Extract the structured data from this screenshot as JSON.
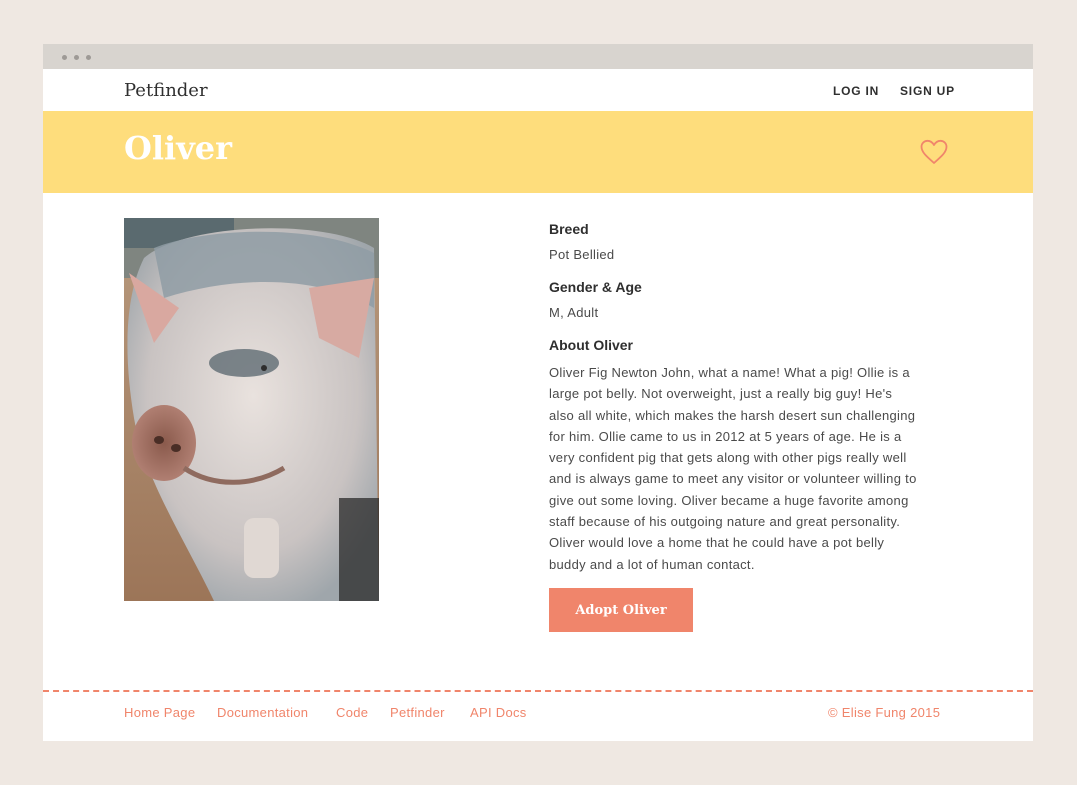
{
  "nav": {
    "brand": "Petfinder",
    "login": "LOG IN",
    "signup": "SIGN UP"
  },
  "pet": {
    "name": "Oliver",
    "breed_label": "Breed",
    "breed": "Pot Bellied",
    "gender_age_label": "Gender & Age",
    "gender_age": "M, Adult",
    "about_label": "About Oliver",
    "about_lines": [
      "Oliver Fig Newton John, what a name! What a pig! Ollie is a",
      "large pot belly. Not overweight, just a really big guy! He's",
      "also all white, which makes the harsh desert sun challenging",
      "for him. Ollie came to us in 2012 at 5 years of age. He is a",
      "very confident pig that gets along with other pigs really well",
      "and is always game to meet any visitor or volunteer willing to",
      "give out some loving. Oliver became a huge favorite among",
      "staff because of his outgoing nature and great personality.",
      "Oliver would love a home that he could have a pot belly",
      "buddy and a lot of human contact."
    ],
    "adopt_button": "Adopt Oliver"
  },
  "footer": {
    "links": [
      "Home Page",
      "Documentation",
      "Code",
      "Petfinder",
      "API Docs"
    ],
    "copyright": "© Elise Fung 2015"
  },
  "icons": {
    "favorite": "heart-icon",
    "photo": "pig-photo"
  },
  "colors": {
    "banner": "#fedd7c",
    "accent": "#f0856b",
    "background": "#efe8e2"
  }
}
